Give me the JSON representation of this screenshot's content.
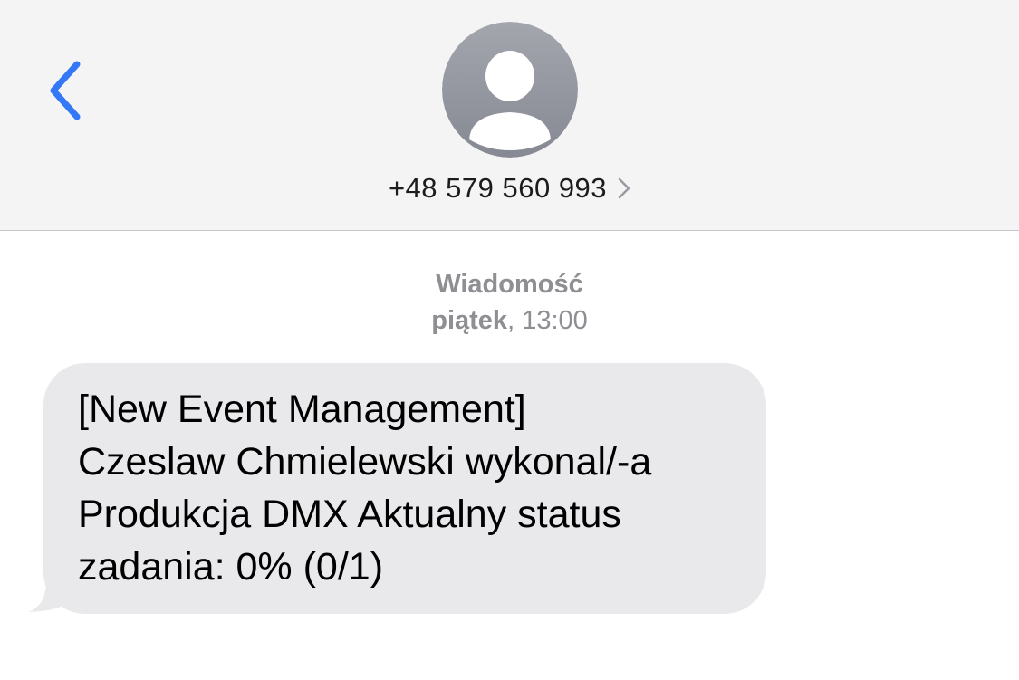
{
  "colors": {
    "accent": "#3478f6",
    "header_bg": "#f4f4f5",
    "bubble_bg": "#e9e9eb",
    "secondary_text": "#8e8e93",
    "avatar_gradient_top": "#a3a6ad",
    "avatar_gradient_bottom": "#868993"
  },
  "header": {
    "back_icon": "chevron-left-icon",
    "avatar_icon": "person-silhouette-icon",
    "contact_number": "+48 579 560 993",
    "details_icon": "chevron-right-icon"
  },
  "conversation": {
    "service_label": "Wiadomość",
    "timestamp_day": "piątek",
    "timestamp_sep": ", ",
    "timestamp_time": "13:00",
    "messages": [
      {
        "direction": "incoming",
        "text": "[New Event Management]\nCzeslaw Chmielewski wykonal/-a\nProdukcja DMX Aktualny status\nzadania: 0% (0/1)"
      }
    ]
  }
}
